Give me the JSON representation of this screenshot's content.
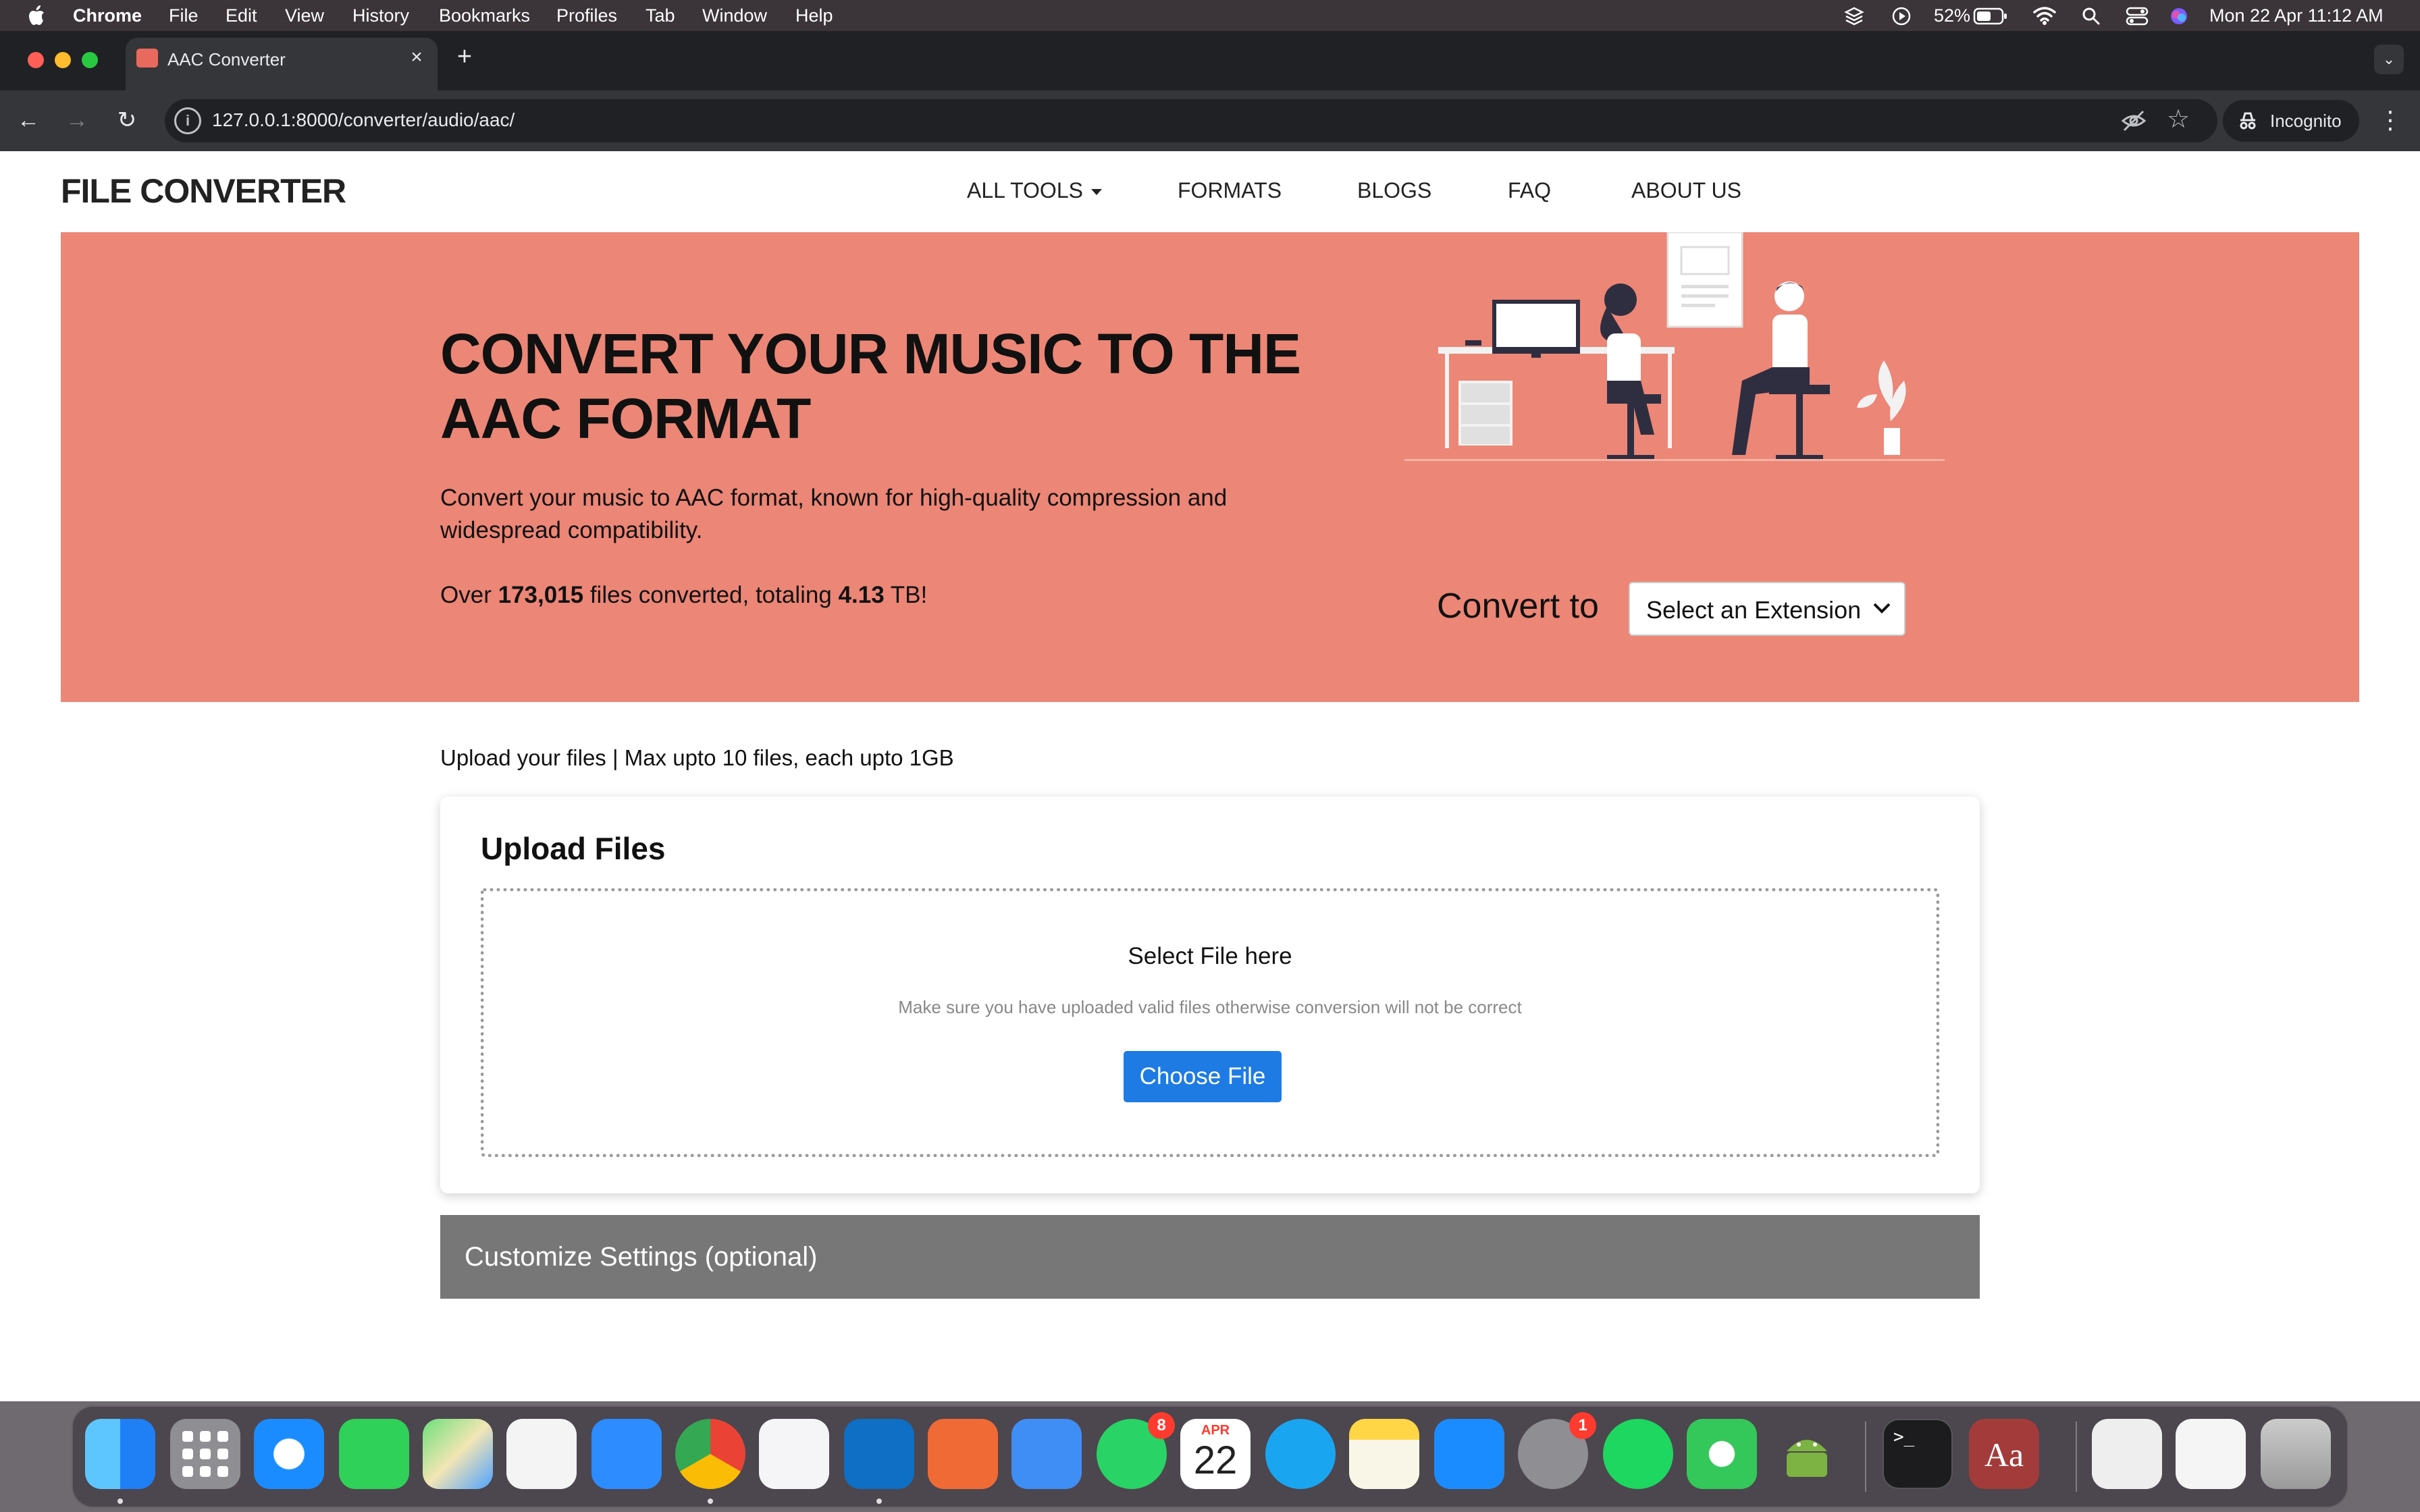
{
  "menubar": {
    "app": "Chrome",
    "items": [
      "File",
      "Edit",
      "View",
      "History",
      "Bookmarks",
      "Profiles",
      "Tab",
      "Window",
      "Help"
    ],
    "battery": "52%",
    "datetime": "Mon 22 Apr  11:12 AM"
  },
  "browser": {
    "tab_title": "AAC Converter",
    "url": "127.0.0.1:8000/converter/audio/aac/",
    "incognito_label": "Incognito"
  },
  "site": {
    "logo": "FILE CONVERTER",
    "nav": {
      "all_tools": "ALL TOOLS",
      "formats": "FORMATS",
      "blogs": "BLOGS",
      "faq": "FAQ",
      "about": "ABOUT US"
    }
  },
  "hero": {
    "title_line1": "CONVERT YOUR MUSIC TO THE",
    "title_line2": "AAC FORMAT",
    "subtitle": "Convert your music to AAC format, known for high-quality compression and widespread compatibility.",
    "stats_prefix": "Over ",
    "files_count": "173,015",
    "stats_middle": " files converted, totaling ",
    "total_size": "4.13",
    "stats_suffix": " TB!",
    "convert_to_label": "Convert to",
    "select_placeholder": "Select an Extension"
  },
  "upload": {
    "note": "Upload your files | Max upto 10 files, each upto 1GB",
    "card_title": "Upload Files",
    "dropzone_title": "Select File here",
    "dropzone_hint": "Make sure you have uploaded valid files otherwise conversion will not be correct",
    "choose_button": "Choose File"
  },
  "customize": {
    "label": "Customize Settings (optional)"
  },
  "dock": {
    "calendar_month": "APR",
    "calendar_day": "22",
    "whatsapp_badge": "8",
    "settings_badge": "1",
    "dictionary_label": "Aa"
  },
  "colors": {
    "hero_bg": "#ec8676",
    "button_blue": "#1e7be3",
    "customize_bg": "#777777"
  }
}
